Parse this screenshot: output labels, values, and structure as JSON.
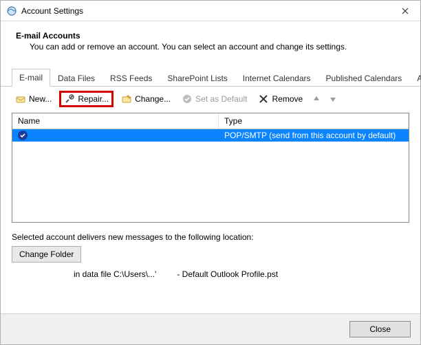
{
  "window": {
    "title": "Account Settings"
  },
  "header": {
    "title": "E-mail Accounts",
    "subtitle": "You can add or remove an account. You can select an account and change its settings."
  },
  "tabs": [
    {
      "label": "E-mail",
      "active": true
    },
    {
      "label": "Data Files"
    },
    {
      "label": "RSS Feeds"
    },
    {
      "label": "SharePoint Lists"
    },
    {
      "label": "Internet Calendars"
    },
    {
      "label": "Published Calendars"
    },
    {
      "label": "Address Books"
    }
  ],
  "toolbar": {
    "new_label": "New...",
    "repair_label": "Repair...",
    "change_label": "Change...",
    "set_default_label": "Set as Default",
    "remove_label": "Remove"
  },
  "list": {
    "col_name": "Name",
    "col_type": "Type",
    "rows": [
      {
        "name": "",
        "type": "POP/SMTP (send from this account by default)",
        "is_default": true
      }
    ]
  },
  "location": {
    "intro": "Selected account delivers new messages to the following location:",
    "change_folder_label": "Change Folder",
    "path_prefix": "in data file C:\\Users\\...'",
    "path_suffix": "- Default Outlook Profile.pst"
  },
  "footer": {
    "close_label": "Close"
  }
}
